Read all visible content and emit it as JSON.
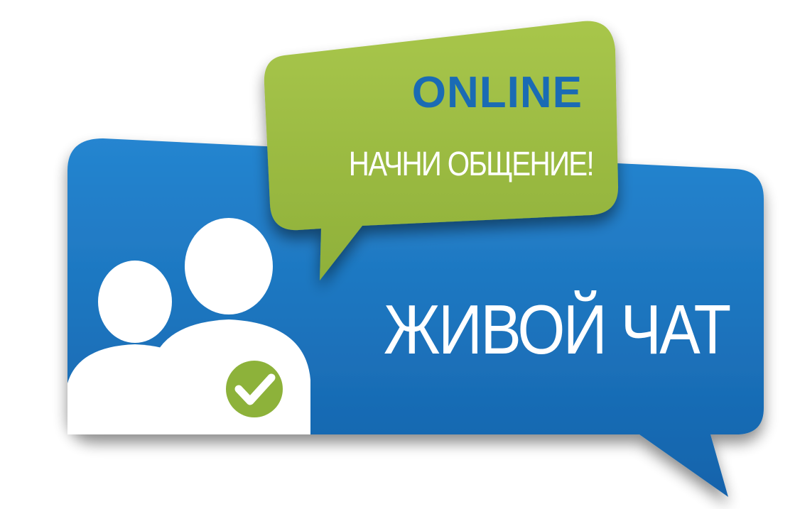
{
  "banner": {
    "online_label": "ONLINE",
    "start_chat_label": "НАЧНИ ОБЩЕНИЕ!",
    "live_chat_label": "ЖИВОЙ ЧАТ"
  },
  "icons": {
    "people": "users-icon",
    "check": "check-icon"
  },
  "colors": {
    "blue_bubble": "#1a6bb4",
    "green_bubble": "#9cbb3f",
    "online_text": "#1a6bb4",
    "white_text": "#ffffff"
  }
}
